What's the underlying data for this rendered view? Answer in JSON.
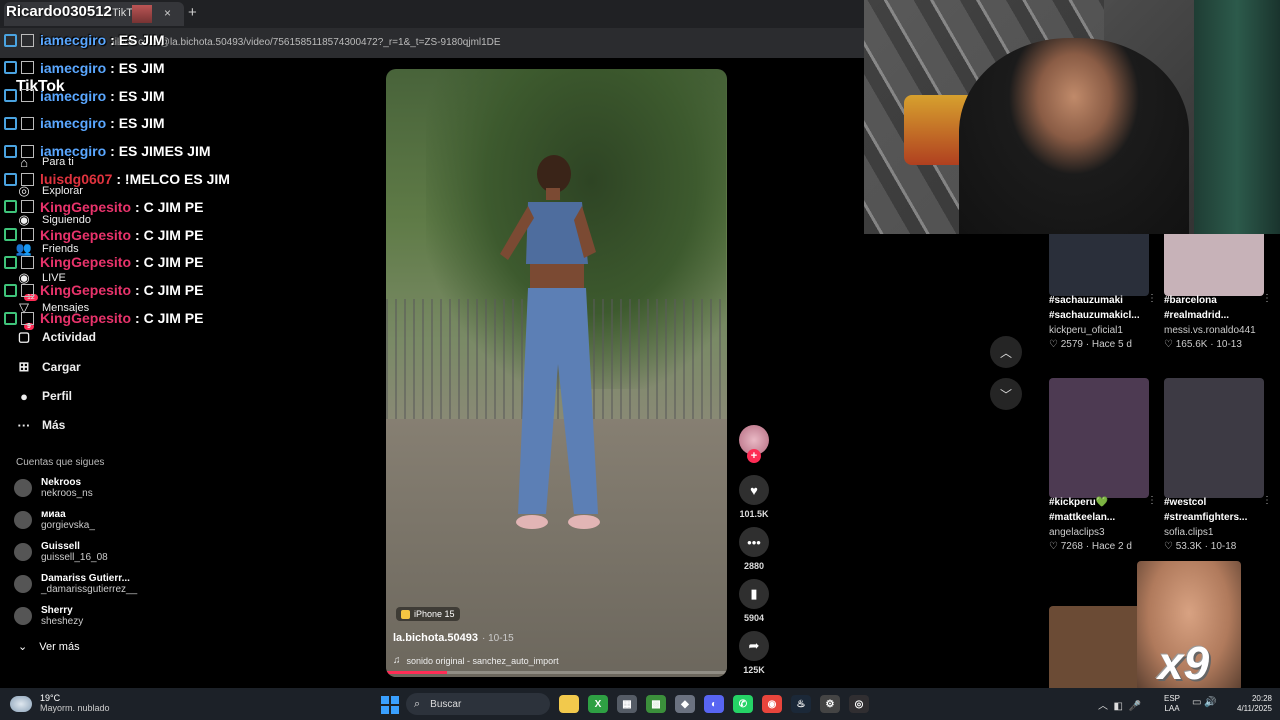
{
  "browser": {
    "tab_title": "TikTok",
    "tab_close": "×",
    "new_tab": "+",
    "url": "tiktok.com/@la.bichota.50493/video/7561585118574300472?_r=1&_t=ZS-9180qjml1DE"
  },
  "sidebar": {
    "logo": "TikTok",
    "nav": [
      {
        "label": "Para ti",
        "icon": "home-icon",
        "glyph": "⌂"
      },
      {
        "label": "Explorar",
        "icon": "compass-icon",
        "glyph": "◎"
      },
      {
        "label": "Siguiendo",
        "icon": "following-icon",
        "glyph": "◉"
      },
      {
        "label": "Friends",
        "icon": "friends-icon",
        "glyph": "👥"
      },
      {
        "label": "LIVE",
        "icon": "live-icon",
        "glyph": "◉"
      },
      {
        "label": "Mensajes",
        "icon": "messages-icon",
        "glyph": "▽",
        "badge": "12"
      },
      {
        "label": "Actividad",
        "icon": "activity-icon",
        "glyph": "▢",
        "badge": "9"
      },
      {
        "label": "Cargar",
        "icon": "upload-icon",
        "glyph": "⊞"
      },
      {
        "label": "Perfil",
        "icon": "profile-icon",
        "glyph": "●"
      },
      {
        "label": "Más",
        "icon": "more-icon",
        "glyph": "···"
      }
    ],
    "following_title": "Cuentas que sigues",
    "accounts": [
      {
        "name": "Nekroos",
        "handle": "nekroos_ns"
      },
      {
        "name": "миаа",
        "handle": "gorgievska_"
      },
      {
        "name": "Guissell",
        "handle": "guissell_16_08"
      },
      {
        "name": "Damariss Gutierr...",
        "handle": "_damarissgutierrez__"
      },
      {
        "name": "Sherry",
        "handle": "sheshezy"
      }
    ],
    "see_more": "Ver más"
  },
  "chat": {
    "streamer": "Ricardo030512",
    "messages": [
      {
        "user": "iamecgiro",
        "user_color": "#5aa7ff",
        "text": ": ES JIM",
        "badge": "blue"
      },
      {
        "user": "iamecgiro",
        "user_color": "#5aa7ff",
        "text": ": ES JIM",
        "badge": "blue"
      },
      {
        "user": "iamecgiro",
        "user_color": "#5aa7ff",
        "text": ": ES JIM",
        "badge": "blue"
      },
      {
        "user": "iamecgiro",
        "user_color": "#5aa7ff",
        "text": ": ES JIM",
        "badge": "blue"
      },
      {
        "user": "iamecgiro",
        "user_color": "#5aa7ff",
        "text": ": ES JIMES JIM",
        "badge": "blue"
      },
      {
        "user": "luisdg0607",
        "user_color": "#e0333e",
        "text": ": !MELCO ES JIM",
        "badge": "blue"
      },
      {
        "user": "KingGepesito",
        "user_color": "#e8336b",
        "text": ": C JIM PE",
        "badge": "green"
      },
      {
        "user": "KingGepesito",
        "user_color": "#e8336b",
        "text": ": C JIM PE",
        "badge": "green"
      },
      {
        "user": "KingGepesito",
        "user_color": "#e8336b",
        "text": ": C JIM PE",
        "badge": "green"
      },
      {
        "user": "KingGepesito",
        "user_color": "#e8336b",
        "text": ": C JIM PE",
        "badge": "green"
      },
      {
        "user": "KingGepesito",
        "user_color": "#e8336b",
        "text": ": C JIM PE",
        "badge": "green"
      }
    ]
  },
  "video": {
    "device": "iPhone 15",
    "author": "la.bichota.50493",
    "date": "· 10-15",
    "music": "sonido original - sanchez_auto_import",
    "progress": 0.18,
    "likes": "101.5K",
    "comments": "2880",
    "saves": "5904",
    "shares": "125K"
  },
  "recommended": [
    {
      "title1": "#sachauzumaki",
      "title2": "#sachauzumakicl...",
      "author": "kickperu_oficial1",
      "stats": "♡ 2579 · Hace 5 d",
      "thumb": "#2a2f3a"
    },
    {
      "title1": "#barcelona",
      "title2": "#realmadrid...",
      "author": "messi.vs.ronaldo441",
      "stats": "♡ 165.6K · 10-13",
      "thumb": "#c7b2b8"
    },
    {
      "title1": "#kickperu💚",
      "title2": "#mattkeelan...",
      "author": "angelaclips3",
      "stats": "♡ 7268 · Hace 2 d",
      "thumb": "#4d3a52"
    },
    {
      "title1": "#westcol",
      "title2": "#streamfighters...",
      "author": "sofia.clips1",
      "stats": "♡ 53.3K · 10-18",
      "thumb": "#3d3a44"
    },
    {
      "title1": "",
      "title2": "",
      "author": "",
      "stats": "",
      "thumb": "#6b4b35"
    }
  ],
  "meme_text": "x9",
  "taskbar": {
    "temp": "19°C",
    "weather": "Mayorm. nublado",
    "search": "Buscar",
    "lang1": "ESP",
    "lang2": "LAA",
    "time": "20:28",
    "date": "4/11/2025",
    "apps": [
      {
        "name": "file-explorer-icon",
        "color": "#f2c94c",
        "glyph": ""
      },
      {
        "name": "xbox-icon",
        "color": "#2ea043",
        "glyph": "X"
      },
      {
        "name": "store-icon",
        "color": "#555c66",
        "glyph": "▦"
      },
      {
        "name": "minecraft-icon",
        "color": "#3b8f3b",
        "glyph": "▩"
      },
      {
        "name": "app-icon",
        "color": "#6b7280",
        "glyph": "◆"
      },
      {
        "name": "discord-icon",
        "color": "#5865f2",
        "glyph": "◐"
      },
      {
        "name": "whatsapp-icon",
        "color": "#25d366",
        "glyph": "✆"
      },
      {
        "name": "chrome-icon",
        "color": "#e8453c",
        "glyph": "◉"
      },
      {
        "name": "steam-icon",
        "color": "#1b2838",
        "glyph": "♨"
      },
      {
        "name": "settings-icon",
        "color": "#444",
        "glyph": "⚙"
      },
      {
        "name": "obs-icon",
        "color": "#302e31",
        "glyph": "◎"
      }
    ]
  }
}
